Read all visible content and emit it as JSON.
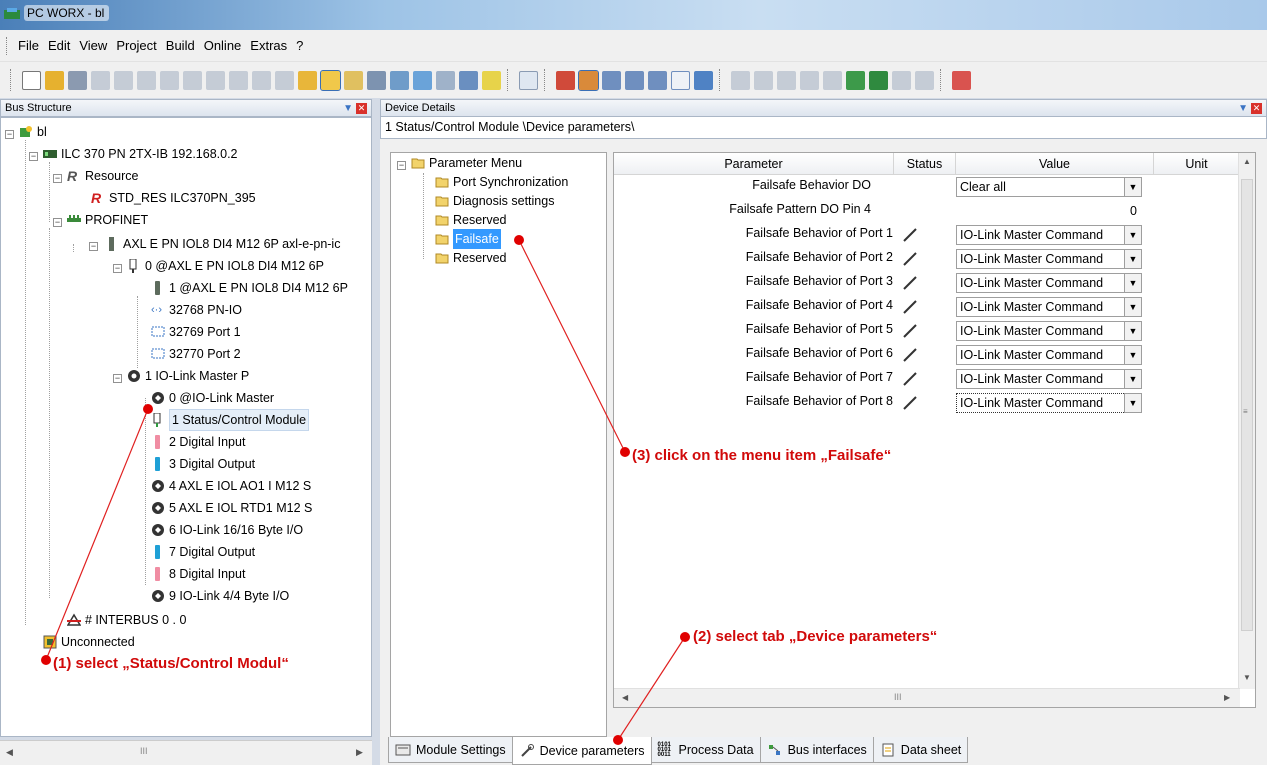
{
  "window": {
    "title": "PC WORX - bl"
  },
  "menu": [
    "File",
    "Edit",
    "View",
    "Project",
    "Build",
    "Online",
    "Extras",
    "?"
  ],
  "bus_structure": {
    "title": "Bus Structure",
    "nodes": [
      "bl",
      "ILC 370 PN 2TX-IB 192.168.0.2",
      "Resource",
      "STD_RES ILC370PN_395",
      "PROFINET",
      "AXL E PN IOL8 DI4 M12 6P axl-e-pn-ic",
      "0 @AXL E PN IOL8 DI4 M12 6P",
      "1 @AXL E PN IOL8 DI4 M12 6P",
      "32768 PN-IO",
      "32769 Port 1",
      "32770 Port 2",
      "1 IO-Link Master P",
      "0 @IO-Link Master",
      "1 Status/Control Module",
      "2 Digital Input",
      "3 Digital Output",
      "4 AXL E IOL AO1 I M12 S",
      "5 AXL E IOL RTD1 M12 S",
      "6 IO-Link 16/16 Byte I/O",
      "7 Digital Output",
      "8 Digital Input",
      "9 IO-Link 4/4 Byte I/O",
      "# INTERBUS 0 . 0",
      "Unconnected"
    ]
  },
  "device_details": {
    "title": "Device Details",
    "path": "1 Status/Control Module \\Device parameters\\",
    "menu": [
      "Parameter Menu",
      "Port Synchronization",
      "Diagnosis settings",
      "Reserved",
      "Failsafe",
      "Reserved"
    ],
    "table": {
      "headers": [
        "Parameter",
        "Status",
        "Value",
        "Unit"
      ],
      "rows": [
        {
          "name": "Failsafe Behavior DO",
          "value": "Clear all"
        },
        {
          "name": "Failsafe Pattern DO Pin 4",
          "value": "0"
        },
        {
          "name": "Failsafe Behavior of Port 1",
          "value": "IO-Link Master Command"
        },
        {
          "name": "Failsafe Behavior of Port 2",
          "value": "IO-Link Master Command"
        },
        {
          "name": "Failsafe Behavior of Port 3",
          "value": "IO-Link Master Command"
        },
        {
          "name": "Failsafe Behavior of Port 4",
          "value": "IO-Link Master Command"
        },
        {
          "name": "Failsafe Behavior of Port 5",
          "value": "IO-Link Master Command"
        },
        {
          "name": "Failsafe Behavior of Port 6",
          "value": "IO-Link Master Command"
        },
        {
          "name": "Failsafe Behavior of Port 7",
          "value": "IO-Link Master Command"
        },
        {
          "name": "Failsafe Behavior of Port 8",
          "value": "IO-Link Master Command"
        }
      ]
    },
    "tabs": [
      "Module Settings",
      "Device parameters",
      "Process Data",
      "Bus interfaces",
      "Data sheet"
    ]
  },
  "annotations": {
    "step1": "(1)  select „Status/Control Modul“",
    "step2": "(2) select tab „Device parameters“",
    "step3": "(3) click on the menu item „Failsafe“"
  }
}
